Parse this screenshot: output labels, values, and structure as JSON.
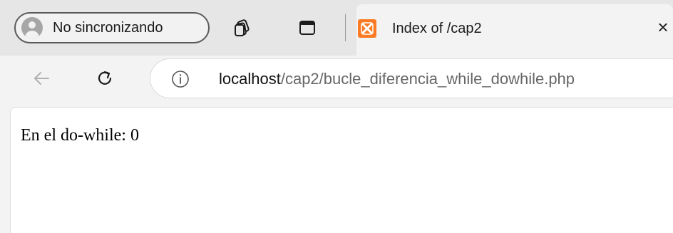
{
  "profile": {
    "label": "No sincronizando"
  },
  "tabs": {
    "active": {
      "title": "Index of /cap2",
      "close_label": "×"
    }
  },
  "address": {
    "host": "localhost",
    "path": "/cap2/bucle_diferencia_while_dowhile.php"
  },
  "page": {
    "text": "En el do-while: 0"
  },
  "colors": {
    "favicon": "#fb7a24",
    "tabstrip": "#e6e6e6",
    "toolbar": "#f3f3f3"
  },
  "icons": {
    "profile": "avatar-icon",
    "workspaces": "workspaces-icon",
    "vertical_tabs": "tab-actions-icon",
    "favicon": "xampp-icon",
    "back": "back-arrow-icon",
    "reload": "reload-icon",
    "site_info": "info-icon"
  }
}
